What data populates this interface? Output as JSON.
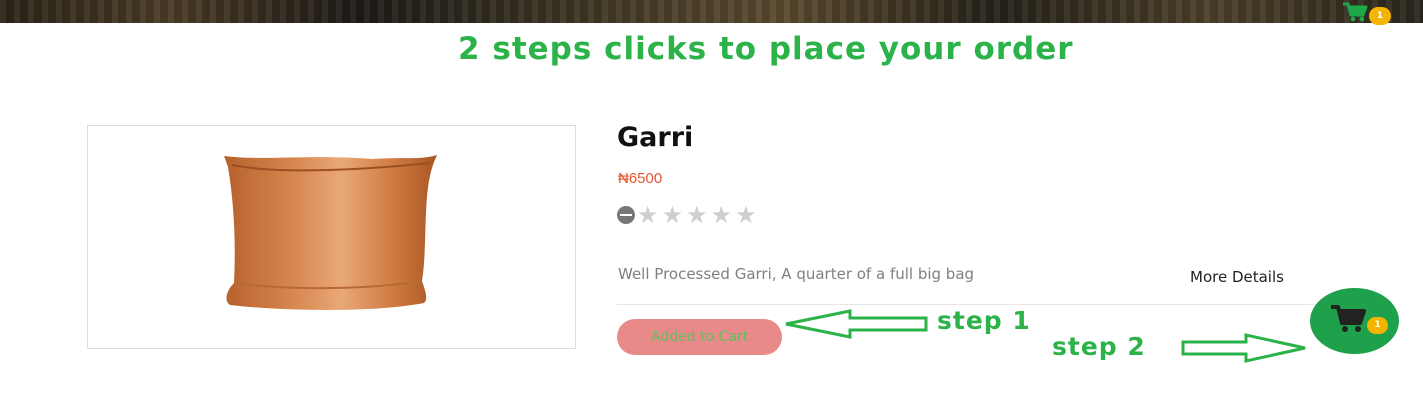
{
  "header": {
    "cart_icon": "shopping-cart-icon",
    "cart_count": "1",
    "accent_color": "#2bb34a",
    "badge_color": "#f4b400"
  },
  "headline": "2 steps clicks to place your order",
  "product": {
    "title": "Garri",
    "price": "₦6500",
    "rating": {
      "icon": "minus-circle-icon",
      "stars_total": 5,
      "stars_filled": 0
    },
    "description": "Well Processed Garri, A quarter of a full big bag",
    "more_details_label": "More Details",
    "add_button_label": "Added to Cart",
    "add_button_color": "#e88a8a",
    "price_color": "#e2572f"
  },
  "annotations": {
    "step1_label": "step 1",
    "step2_label": "step 2"
  },
  "floating_cart": {
    "icon": "shopping-cart-icon",
    "count": "1",
    "bg_color": "#1ea14a"
  }
}
